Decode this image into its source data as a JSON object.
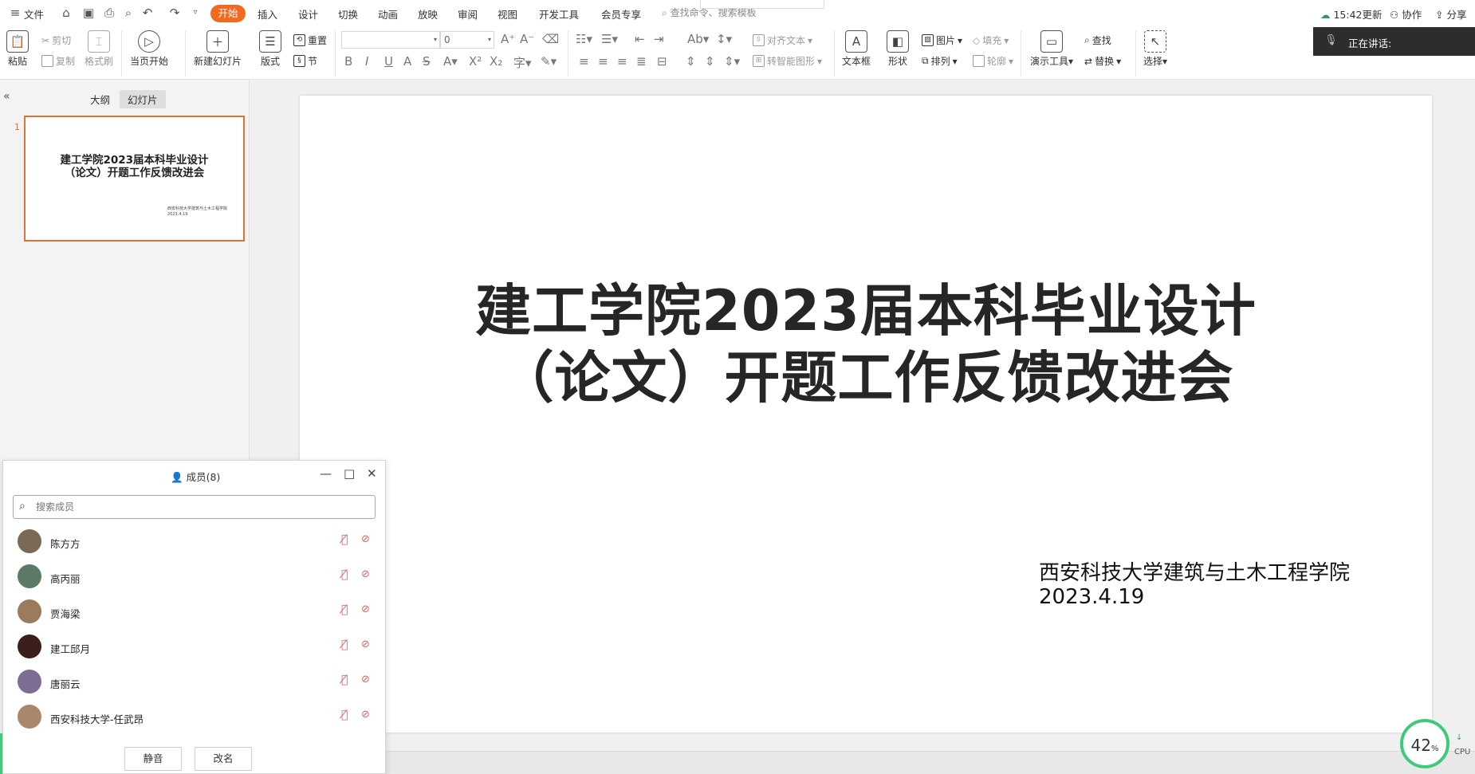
{
  "menu": {
    "file": "文件",
    "tabs": [
      "开始",
      "插入",
      "设计",
      "切换",
      "动画",
      "放映",
      "审阅",
      "视图",
      "开发工具",
      "会员专享"
    ],
    "search_placeholder": "查找命令、搜索模板",
    "update": "15:42更新",
    "collab": "协作",
    "share": "分享"
  },
  "ribbon": {
    "paste": "粘贴",
    "cut": "剪切",
    "copy": "复制",
    "format_painter": "格式刷",
    "start_current": "当页开始",
    "new_slide": "新建幻灯片",
    "layout": "版式",
    "reset": "重置",
    "section": "节",
    "font_size": "0",
    "align_text": "对齐文本",
    "smart_art": "转智能图形",
    "textbox": "文本框",
    "shape": "形状",
    "picture": "图片",
    "arrange": "排列",
    "fill": "填充",
    "outline": "轮廓",
    "present_tools": "演示工具",
    "find": "查找",
    "replace": "替换",
    "select": "选择"
  },
  "speaking": {
    "label": "正在讲话:"
  },
  "left_pane": {
    "tab_outline": "大纲",
    "tab_slides": "幻灯片",
    "slide_number": "1",
    "thumb_title_line1": "建工学院2023届本科毕业设计",
    "thumb_title_line2": "（论文）开题工作反馈改进会",
    "thumb_sub_line1": "西安科技大学建筑与土木工程学院",
    "thumb_sub_line2": "2023.4.19"
  },
  "slide": {
    "title_line1": "建工学院2023届本科毕业设计",
    "title_line2": "（论文）开题工作反馈改进会",
    "subtitle_line1": "西安科技大学建筑与土木工程学院",
    "subtitle_line2": "2023.4.19"
  },
  "members_panel": {
    "title": "成员(8)",
    "search_placeholder": "搜索成员",
    "members": [
      {
        "name": "陈方方",
        "avatar_color": "#7a6a55"
      },
      {
        "name": "高丙丽",
        "avatar_color": "#5d7a66"
      },
      {
        "name": "贾海梁",
        "avatar_color": "#9a7b5e"
      },
      {
        "name": "建工邱月",
        "avatar_color": "#3a1f1a"
      },
      {
        "name": "唐丽云",
        "avatar_color": "#7d6d92"
      },
      {
        "name": "西安科技大学-任武昂",
        "avatar_color": "#a8876a"
      }
    ],
    "mute_button": "静音",
    "rename_button": "改名"
  },
  "cpu": {
    "value": "42",
    "unit": "%",
    "label": "CPU"
  },
  "colors": {
    "accent": "#f26a21",
    "cpu_ring": "#3fc97b"
  }
}
